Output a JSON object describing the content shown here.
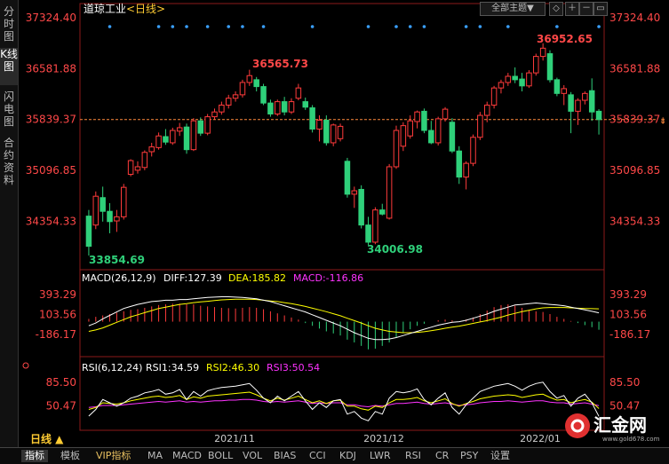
{
  "sidebar": {
    "tabs": [
      {
        "label": "分时图"
      },
      {
        "label": "K线图",
        "active": true
      },
      {
        "label": "闪电图"
      },
      {
        "label": "合约资料"
      }
    ]
  },
  "header": {
    "title": "道琼工业",
    "period": "<日线>",
    "theme_select": "全部主题▼",
    "icons": [
      "chart-settings-icon",
      "zoom-in-icon",
      "zoom-out-icon",
      "panel-icon"
    ]
  },
  "colors": {
    "up": "#ff3b3b",
    "down": "#2fd07a",
    "ma1": "#ffffff",
    "ma2": "#ffff00",
    "ma3": "#ff33ff",
    "dash": "#ff8a3d",
    "dot": "#3aa0ff"
  },
  "chart_data": [
    {
      "type": "candlestick",
      "title": "道琼工业 <日线>",
      "y_ticks": [
        "37324.40",
        "36581.88",
        "35839.37",
        "35096.85",
        "34354.33"
      ],
      "ylim": [
        33700,
        37324.4
      ],
      "reference_line": {
        "value": 35839.37,
        "label": "35839.37"
      },
      "high_label": "36952.65",
      "low_label": "33854.69",
      "annotations": [
        "36565.73",
        "34006.98"
      ],
      "x_ticks": [
        "2021/11",
        "2021/12",
        "2022/01"
      ],
      "candles": [
        {
          "o": 34430,
          "h": 34520,
          "l": 33854.69,
          "c": 33990
        },
        {
          "o": 34300,
          "h": 34790,
          "l": 34240,
          "c": 34720
        },
        {
          "o": 34700,
          "h": 34860,
          "l": 34350,
          "c": 34500
        },
        {
          "o": 34500,
          "h": 34620,
          "l": 34180,
          "c": 34350
        },
        {
          "o": 34360,
          "h": 34520,
          "l": 34200,
          "c": 34420
        },
        {
          "o": 34420,
          "h": 34900,
          "l": 34380,
          "c": 34850
        },
        {
          "o": 35040,
          "h": 35260,
          "l": 35010,
          "c": 35240
        },
        {
          "o": 35100,
          "h": 35230,
          "l": 35050,
          "c": 35150
        },
        {
          "o": 35140,
          "h": 35390,
          "l": 35100,
          "c": 35360
        },
        {
          "o": 35370,
          "h": 35500,
          "l": 35300,
          "c": 35440
        },
        {
          "o": 35430,
          "h": 35650,
          "l": 35400,
          "c": 35600
        },
        {
          "o": 35590,
          "h": 35700,
          "l": 35470,
          "c": 35510
        },
        {
          "o": 35500,
          "h": 35720,
          "l": 35470,
          "c": 35680
        },
        {
          "o": 35670,
          "h": 35790,
          "l": 35600,
          "c": 35720
        },
        {
          "o": 35730,
          "h": 35780,
          "l": 35340,
          "c": 35400
        },
        {
          "o": 35400,
          "h": 35860,
          "l": 35380,
          "c": 35820
        },
        {
          "o": 35820,
          "h": 35870,
          "l": 35600,
          "c": 35640
        },
        {
          "o": 35640,
          "h": 35920,
          "l": 35610,
          "c": 35880
        },
        {
          "o": 35880,
          "h": 36000,
          "l": 35840,
          "c": 35950
        },
        {
          "o": 35950,
          "h": 36100,
          "l": 35910,
          "c": 36050
        },
        {
          "o": 36050,
          "h": 36200,
          "l": 36000,
          "c": 36150
        },
        {
          "o": 36150,
          "h": 36250,
          "l": 36100,
          "c": 36200
        },
        {
          "o": 36200,
          "h": 36420,
          "l": 36160,
          "c": 36380
        },
        {
          "o": 36380,
          "h": 36565.73,
          "l": 36330,
          "c": 36480
        },
        {
          "o": 36420,
          "h": 36460,
          "l": 36250,
          "c": 36320
        },
        {
          "o": 36320,
          "h": 36360,
          "l": 36050,
          "c": 36080
        },
        {
          "o": 36080,
          "h": 36130,
          "l": 35880,
          "c": 35920
        },
        {
          "o": 35920,
          "h": 36130,
          "l": 35890,
          "c": 36100
        },
        {
          "o": 36100,
          "h": 36170,
          "l": 35900,
          "c": 35950
        },
        {
          "o": 35950,
          "h": 36150,
          "l": 35920,
          "c": 36100
        },
        {
          "o": 36150,
          "h": 36360,
          "l": 36120,
          "c": 36300
        },
        {
          "o": 36100,
          "h": 36160,
          "l": 35980,
          "c": 36020
        },
        {
          "o": 36010,
          "h": 36050,
          "l": 35650,
          "c": 35700
        },
        {
          "o": 35700,
          "h": 35900,
          "l": 35520,
          "c": 35830
        },
        {
          "o": 35830,
          "h": 35900,
          "l": 35460,
          "c": 35500
        },
        {
          "o": 35500,
          "h": 35780,
          "l": 35450,
          "c": 35760
        },
        {
          "o": 35560,
          "h": 35780,
          "l": 35520,
          "c": 35740
        },
        {
          "o": 35230,
          "h": 35280,
          "l": 34700,
          "c": 34750
        },
        {
          "o": 34750,
          "h": 34860,
          "l": 34550,
          "c": 34800
        },
        {
          "o": 34820,
          "h": 34880,
          "l": 34250,
          "c": 34300
        },
        {
          "o": 34300,
          "h": 34420,
          "l": 34006.98,
          "c": 34050
        },
        {
          "o": 34050,
          "h": 34560,
          "l": 34020,
          "c": 34520
        },
        {
          "o": 34520,
          "h": 34610,
          "l": 34440,
          "c": 34460
        },
        {
          "o": 34400,
          "h": 35190,
          "l": 34380,
          "c": 35150
        },
        {
          "o": 35150,
          "h": 35750,
          "l": 35120,
          "c": 35680
        },
        {
          "o": 35450,
          "h": 35800,
          "l": 35380,
          "c": 35750
        },
        {
          "o": 35600,
          "h": 35900,
          "l": 35560,
          "c": 35820
        },
        {
          "o": 35810,
          "h": 35970,
          "l": 35710,
          "c": 35950
        },
        {
          "o": 35960,
          "h": 36000,
          "l": 35640,
          "c": 35680
        },
        {
          "o": 35680,
          "h": 35820,
          "l": 35480,
          "c": 35500
        },
        {
          "o": 35500,
          "h": 35880,
          "l": 35460,
          "c": 35850
        },
        {
          "o": 35850,
          "h": 36020,
          "l": 35810,
          "c": 35990
        },
        {
          "o": 35800,
          "h": 35860,
          "l": 35350,
          "c": 35380
        },
        {
          "o": 35380,
          "h": 35450,
          "l": 34900,
          "c": 35000
        },
        {
          "o": 35000,
          "h": 35230,
          "l": 34820,
          "c": 35200
        },
        {
          "o": 35200,
          "h": 35620,
          "l": 35160,
          "c": 35580
        },
        {
          "o": 35580,
          "h": 35950,
          "l": 35540,
          "c": 35900
        },
        {
          "o": 35900,
          "h": 36100,
          "l": 35800,
          "c": 36050
        },
        {
          "o": 36050,
          "h": 36330,
          "l": 36000,
          "c": 36300
        },
        {
          "o": 36300,
          "h": 36420,
          "l": 36220,
          "c": 36380
        },
        {
          "o": 36380,
          "h": 36520,
          "l": 36330,
          "c": 36470
        },
        {
          "o": 36470,
          "h": 36600,
          "l": 36370,
          "c": 36420
        },
        {
          "o": 36430,
          "h": 36520,
          "l": 36250,
          "c": 36330
        },
        {
          "o": 36330,
          "h": 36560,
          "l": 36300,
          "c": 36520
        },
        {
          "o": 36520,
          "h": 36800,
          "l": 36480,
          "c": 36760
        },
        {
          "o": 36760,
          "h": 36952.65,
          "l": 36700,
          "c": 36880
        },
        {
          "o": 36800,
          "h": 36850,
          "l": 36380,
          "c": 36420
        },
        {
          "o": 36420,
          "h": 36450,
          "l": 36180,
          "c": 36220
        },
        {
          "o": 36220,
          "h": 36340,
          "l": 36050,
          "c": 36290
        },
        {
          "o": 36200,
          "h": 36240,
          "l": 35640,
          "c": 35960
        },
        {
          "o": 35960,
          "h": 36150,
          "l": 35760,
          "c": 36120
        },
        {
          "o": 36120,
          "h": 36250,
          "l": 36060,
          "c": 36220
        },
        {
          "o": 36260,
          "h": 36440,
          "l": 35820,
          "c": 35950
        },
        {
          "o": 35960,
          "h": 35990,
          "l": 35620,
          "c": 35839
        }
      ]
    },
    {
      "type": "macd",
      "title": "MACD(26,12,9)",
      "diff_label": "DIFF:127.39",
      "dea_label": "DEA:185.82",
      "macd_label": "MACD:-116.86",
      "y_ticks": [
        "393.29",
        "103.56",
        "-186.17"
      ],
      "ylim": [
        -480,
        520
      ],
      "histogram": [
        40,
        70,
        90,
        110,
        130,
        150,
        170,
        180,
        200,
        220,
        240,
        250,
        260,
        260,
        250,
        250,
        230,
        220,
        210,
        200,
        195,
        190,
        200,
        210,
        200,
        180,
        150,
        120,
        90,
        60,
        30,
        -20,
        -60,
        -100,
        -140,
        -170,
        -200,
        -260,
        -300,
        -350,
        -400,
        -390,
        -350,
        -300,
        -230,
        -160,
        -110,
        -60,
        -30,
        0,
        20,
        30,
        20,
        0,
        30,
        60,
        110,
        160,
        210,
        240,
        250,
        230,
        200,
        170,
        150,
        140,
        110,
        70,
        40,
        10,
        -20,
        -50,
        -80,
        -116.86
      ],
      "diff": [
        -60,
        -20,
        40,
        90,
        140,
        190,
        220,
        250,
        270,
        290,
        300,
        310,
        310,
        320,
        320,
        330,
        340,
        350,
        355,
        360,
        360,
        355,
        350,
        340,
        330,
        310,
        290,
        260,
        230,
        200,
        170,
        140,
        100,
        60,
        20,
        -20,
        -60,
        -110,
        -160,
        -200,
        -240,
        -260,
        -260,
        -250,
        -230,
        -200,
        -170,
        -140,
        -110,
        -80,
        -50,
        -30,
        -10,
        0,
        20,
        50,
        80,
        110,
        150,
        180,
        210,
        240,
        250,
        260,
        270,
        260,
        250,
        240,
        230,
        210,
        190,
        170,
        150,
        127.39
      ],
      "dea": [
        -140,
        -120,
        -90,
        -50,
        -10,
        30,
        70,
        100,
        130,
        160,
        190,
        210,
        230,
        250,
        260,
        275,
        285,
        295,
        305,
        315,
        320,
        325,
        325,
        325,
        320,
        310,
        300,
        290,
        275,
        260,
        240,
        220,
        195,
        170,
        145,
        115,
        85,
        50,
        15,
        -20,
        -60,
        -95,
        -120,
        -140,
        -150,
        -160,
        -160,
        -155,
        -145,
        -130,
        -115,
        -95,
        -80,
        -65,
        -45,
        -25,
        -5,
        15,
        40,
        65,
        95,
        120,
        145,
        165,
        185,
        200,
        205,
        205,
        205,
        200,
        195,
        190,
        188,
        185.82
      ]
    },
    {
      "type": "rsi",
      "title": "RSI(6,12,24)",
      "rsi1_label": "RSI1:34.59",
      "rsi2_label": "RSI2:46.30",
      "rsi3_label": "RSI3:50.54",
      "y_ticks": [
        "85.50",
        "50.47"
      ],
      "ylim": [
        15,
        95
      ],
      "rsi1": [
        35,
        45,
        60,
        55,
        50,
        55,
        62,
        65,
        70,
        72,
        75,
        68,
        70,
        75,
        60,
        72,
        65,
        73,
        76,
        78,
        79,
        80,
        82,
        84,
        74,
        62,
        55,
        65,
        58,
        65,
        72,
        58,
        45,
        55,
        48,
        58,
        60,
        38,
        42,
        32,
        28,
        42,
        38,
        62,
        72,
        70,
        72,
        76,
        60,
        52,
        62,
        70,
        48,
        38,
        52,
        62,
        72,
        76,
        80,
        82,
        84,
        80,
        74,
        80,
        84,
        86,
        72,
        62,
        66,
        50,
        62,
        68,
        55,
        34.59
      ],
      "rsi2": [
        45,
        48,
        55,
        54,
        53,
        55,
        58,
        60,
        62,
        64,
        65,
        63,
        64,
        66,
        60,
        64,
        62,
        65,
        66,
        67,
        68,
        69,
        70,
        71,
        67,
        62,
        58,
        62,
        59,
        62,
        65,
        60,
        55,
        58,
        54,
        58,
        59,
        50,
        50,
        46,
        44,
        50,
        48,
        55,
        60,
        60,
        61,
        63,
        58,
        55,
        58,
        61,
        54,
        50,
        54,
        57,
        61,
        63,
        65,
        66,
        67,
        66,
        63,
        65,
        67,
        68,
        63,
        59,
        60,
        55,
        58,
        60,
        56,
        46.3
      ],
      "rsi3": [
        48,
        49,
        51,
        51,
        51,
        52,
        53,
        54,
        55,
        56,
        57,
        56,
        57,
        58,
        56,
        57,
        56,
        57,
        58,
        58,
        59,
        59,
        60,
        60,
        59,
        57,
        56,
        57,
        56,
        57,
        58,
        56,
        54,
        55,
        54,
        55,
        55,
        52,
        52,
        50,
        49,
        51,
        50,
        52,
        54,
        54,
        55,
        56,
        54,
        53,
        54,
        55,
        53,
        51,
        52,
        53,
        55,
        56,
        57,
        57,
        58,
        57,
        56,
        57,
        58,
        58,
        56,
        55,
        55,
        53,
        54,
        55,
        53,
        50.54
      ]
    }
  ],
  "watermark": {
    "brand": "汇金网",
    "site": "www.gold678.com"
  },
  "bottom": {
    "period_label": "日线 ▲",
    "tabs": [
      "指标",
      "模板",
      "VIP指标",
      "MA",
      "MACD",
      "BOLL",
      "VOL",
      "BIAS",
      "CCI",
      "KDJ",
      "LWR",
      "RSI",
      "CR",
      "PSY",
      "设置"
    ]
  }
}
